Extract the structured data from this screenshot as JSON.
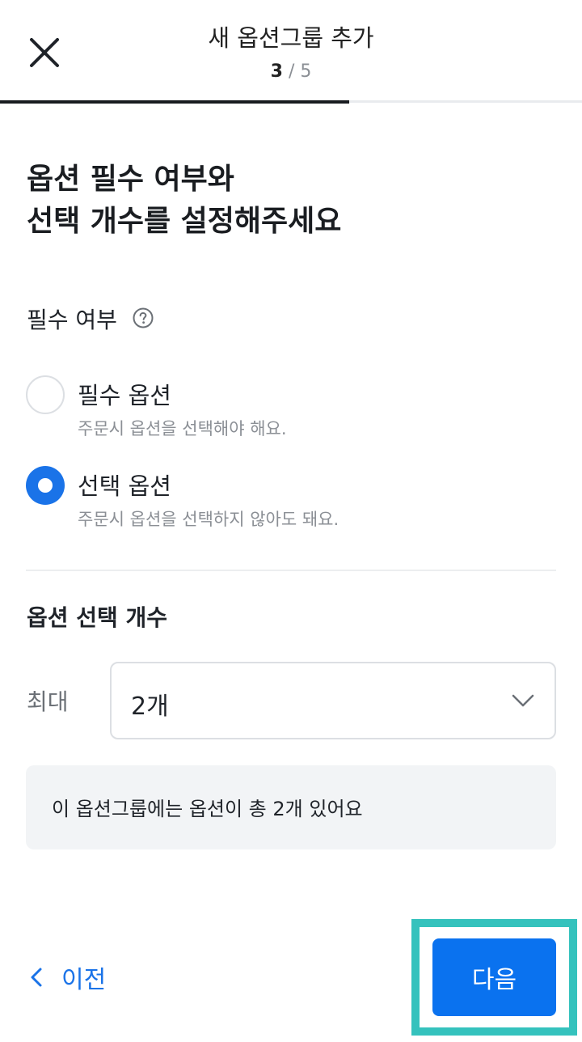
{
  "header": {
    "title": "새 옵션그룹 추가",
    "step_current": "3",
    "step_separator": " / ",
    "step_total": "5",
    "progress": 0.6
  },
  "heading": {
    "line1": "옵션 필수 여부와",
    "line2": "선택 개수를 설정해주세요"
  },
  "required_section": {
    "label": "필수 여부",
    "options": [
      {
        "title": "필수 옵션",
        "description": "주문시 옵션을 선택해야 해요.",
        "selected": false
      },
      {
        "title": "선택 옵션",
        "description": "주문시 옵션을 선택하지 않아도 돼요.",
        "selected": true
      }
    ]
  },
  "count_section": {
    "label": "옵션 선택 개수",
    "max_label": "최대",
    "selected_value": "2개"
  },
  "info": {
    "text": "이 옵션그룹에는 옵션이 총 2개 있어요"
  },
  "footer": {
    "prev_label": "이전",
    "next_label": "다음"
  },
  "colors": {
    "accent": "#0a72ef",
    "highlight": "#35c2bd"
  }
}
